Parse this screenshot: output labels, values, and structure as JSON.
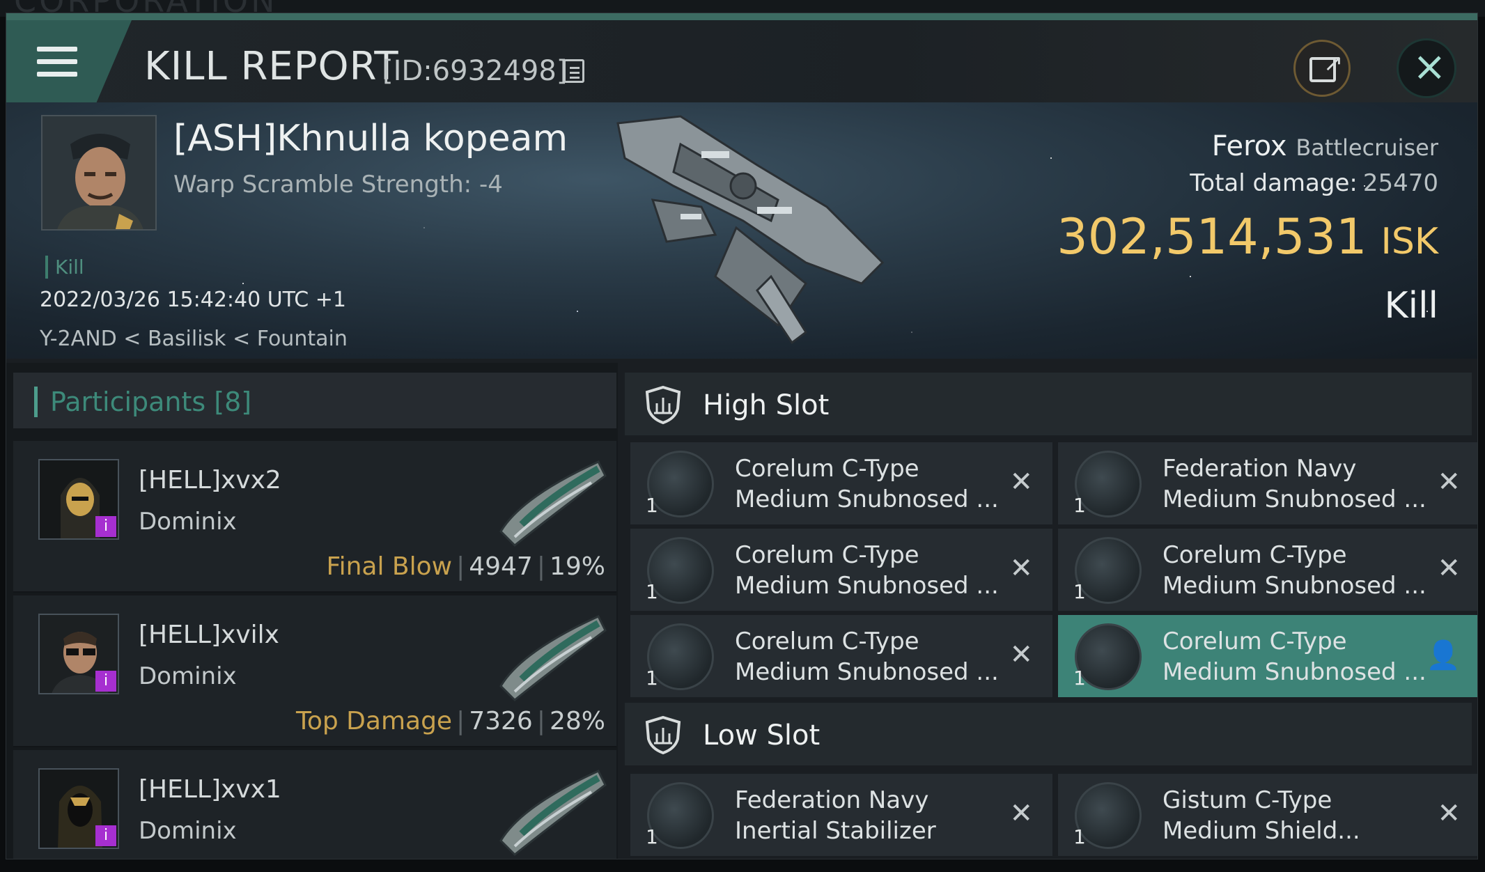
{
  "background": {
    "corp_text": "CORPORATION"
  },
  "header": {
    "title": "KILL REPORT",
    "id_text": "[ID:6932498]"
  },
  "victim": {
    "name": "[ASH]Khnulla kopeam",
    "warp": "Warp Scramble Strength: -4",
    "tag": "Kill",
    "datetime": "2022/03/26 15:42:40 UTC +1",
    "location": "Y-2AND < Basilisk < Fountain",
    "ship": "Ferox",
    "ship_class": "Battlecruiser",
    "damage_label": "Total damage:",
    "damage_value": "25470",
    "isk_value": "302,514,531",
    "isk_unit": "ISK",
    "result": "Kill"
  },
  "participants": {
    "title": "Participants [8]",
    "rows": [
      {
        "name": "[HELL]xvx2",
        "ship": "Dominix",
        "role": "Final Blow",
        "damage": "4947",
        "percent": "19%"
      },
      {
        "name": "[HELL]xvilx",
        "ship": "Dominix",
        "role": "Top Damage",
        "damage": "7326",
        "percent": "28%"
      },
      {
        "name": "[HELL]xvx1",
        "ship": "Dominix",
        "role": "",
        "damage": "",
        "percent": ""
      }
    ]
  },
  "fitting": {
    "high_slot": {
      "label": "High Slot",
      "modules": [
        {
          "line1": "Corelum C-Type",
          "line2": "Medium Snubnosed ...",
          "qty": "1",
          "status": "✕"
        },
        {
          "line1": "Federation Navy",
          "line2": "Medium Snubnosed ...",
          "qty": "1",
          "status": "✕"
        },
        {
          "line1": "Corelum C-Type",
          "line2": "Medium Snubnosed ...",
          "qty": "1",
          "status": "✕"
        },
        {
          "line1": "Corelum C-Type",
          "line2": "Medium Snubnosed ...",
          "qty": "1",
          "status": "✕"
        },
        {
          "line1": "Corelum C-Type",
          "line2": "Medium Snubnosed ...",
          "qty": "1",
          "status": "✕"
        },
        {
          "line1": "Corelum C-Type",
          "line2": "Medium Snubnosed ...",
          "qty": "1",
          "status": "👤"
        }
      ]
    },
    "low_slot": {
      "label": "Low Slot",
      "modules": [
        {
          "line1": "Federation Navy",
          "line2": "Inertial Stabilizer",
          "qty": "1",
          "status": "✕"
        },
        {
          "line1": "Gistum C-Type",
          "line2": "Medium Shield...",
          "qty": "1",
          "status": "✕"
        }
      ]
    }
  },
  "colors": {
    "accent": "#3d8377",
    "isk": "#f2c96a",
    "final_blow": "#c9a24e",
    "badge": "#a62fd0"
  }
}
